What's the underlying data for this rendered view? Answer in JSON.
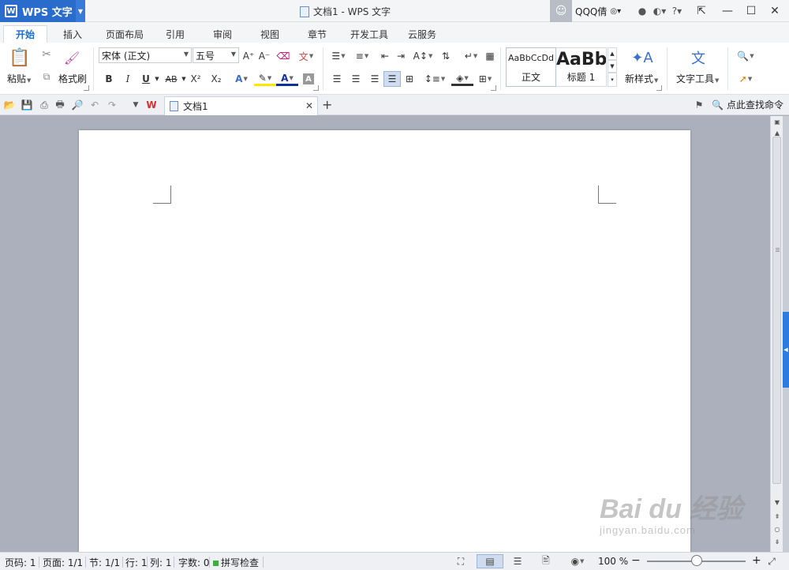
{
  "app": {
    "name": "WPS 文字",
    "window_title": "文档1 - WPS 文字"
  },
  "user": {
    "name": "QQQ倩"
  },
  "menu_tabs": [
    "开始",
    "插入",
    "页面布局",
    "引用",
    "审阅",
    "视图",
    "章节",
    "开发工具",
    "云服务"
  ],
  "ribbon": {
    "paste_label": "粘贴",
    "format_painter_label": "格式刷",
    "font_name": "宋体 (正文)",
    "font_size": "五号",
    "styles": [
      {
        "sample": "AaBbCcDd",
        "label": "正文"
      },
      {
        "sample": "AaBb",
        "label": "标题 1"
      }
    ],
    "new_style_label": "新样式",
    "text_tools_label": "文字工具",
    "bold": "B",
    "italic": "I",
    "underline": "U",
    "strike": "AB",
    "superscript": "X²",
    "subscript": "X₂"
  },
  "document_tabs": [
    {
      "title": "文档1"
    }
  ],
  "command_search": {
    "placeholder": "点此查找命令"
  },
  "status": {
    "page_no": "页码: 1",
    "page_count": "页面: 1/1",
    "section": "节: 1/1",
    "row": "行: 1",
    "col": "列: 1",
    "word_count": "字数: 0",
    "spell_check": "拼写检查",
    "zoom": "100 %"
  },
  "watermark": {
    "main": "Bai du 经验",
    "sub": "jingyan.baidu.com"
  },
  "colors": {
    "accent": "#2a6ccc",
    "workspace": "#abb0bc",
    "active_tab_text": "#1a6cd2"
  }
}
